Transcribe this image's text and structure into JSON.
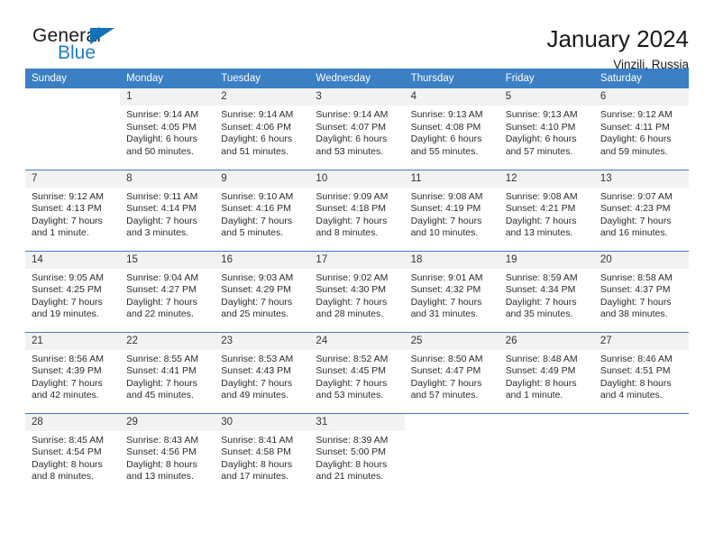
{
  "brand": {
    "name_part1": "General",
    "name_part2": "Blue",
    "flag_icon": "triangle-flag-icon"
  },
  "header": {
    "title": "January 2024",
    "location": "Vinzili, Russia"
  },
  "calendar": {
    "weekday_headers": [
      "Sunday",
      "Monday",
      "Tuesday",
      "Wednesday",
      "Thursday",
      "Friday",
      "Saturday"
    ],
    "header_bg": "#3b7fc4",
    "daynum_bg": "#f2f2f2",
    "weeks": [
      [
        {
          "day": "",
          "sunrise": "",
          "sunset": "",
          "daylight_line1": "",
          "daylight_line2": ""
        },
        {
          "day": "1",
          "sunrise": "Sunrise: 9:14 AM",
          "sunset": "Sunset: 4:05 PM",
          "daylight_line1": "Daylight: 6 hours",
          "daylight_line2": "and 50 minutes."
        },
        {
          "day": "2",
          "sunrise": "Sunrise: 9:14 AM",
          "sunset": "Sunset: 4:06 PM",
          "daylight_line1": "Daylight: 6 hours",
          "daylight_line2": "and 51 minutes."
        },
        {
          "day": "3",
          "sunrise": "Sunrise: 9:14 AM",
          "sunset": "Sunset: 4:07 PM",
          "daylight_line1": "Daylight: 6 hours",
          "daylight_line2": "and 53 minutes."
        },
        {
          "day": "4",
          "sunrise": "Sunrise: 9:13 AM",
          "sunset": "Sunset: 4:08 PM",
          "daylight_line1": "Daylight: 6 hours",
          "daylight_line2": "and 55 minutes."
        },
        {
          "day": "5",
          "sunrise": "Sunrise: 9:13 AM",
          "sunset": "Sunset: 4:10 PM",
          "daylight_line1": "Daylight: 6 hours",
          "daylight_line2": "and 57 minutes."
        },
        {
          "day": "6",
          "sunrise": "Sunrise: 9:12 AM",
          "sunset": "Sunset: 4:11 PM",
          "daylight_line1": "Daylight: 6 hours",
          "daylight_line2": "and 59 minutes."
        }
      ],
      [
        {
          "day": "7",
          "sunrise": "Sunrise: 9:12 AM",
          "sunset": "Sunset: 4:13 PM",
          "daylight_line1": "Daylight: 7 hours",
          "daylight_line2": "and 1 minute."
        },
        {
          "day": "8",
          "sunrise": "Sunrise: 9:11 AM",
          "sunset": "Sunset: 4:14 PM",
          "daylight_line1": "Daylight: 7 hours",
          "daylight_line2": "and 3 minutes."
        },
        {
          "day": "9",
          "sunrise": "Sunrise: 9:10 AM",
          "sunset": "Sunset: 4:16 PM",
          "daylight_line1": "Daylight: 7 hours",
          "daylight_line2": "and 5 minutes."
        },
        {
          "day": "10",
          "sunrise": "Sunrise: 9:09 AM",
          "sunset": "Sunset: 4:18 PM",
          "daylight_line1": "Daylight: 7 hours",
          "daylight_line2": "and 8 minutes."
        },
        {
          "day": "11",
          "sunrise": "Sunrise: 9:08 AM",
          "sunset": "Sunset: 4:19 PM",
          "daylight_line1": "Daylight: 7 hours",
          "daylight_line2": "and 10 minutes."
        },
        {
          "day": "12",
          "sunrise": "Sunrise: 9:08 AM",
          "sunset": "Sunset: 4:21 PM",
          "daylight_line1": "Daylight: 7 hours",
          "daylight_line2": "and 13 minutes."
        },
        {
          "day": "13",
          "sunrise": "Sunrise: 9:07 AM",
          "sunset": "Sunset: 4:23 PM",
          "daylight_line1": "Daylight: 7 hours",
          "daylight_line2": "and 16 minutes."
        }
      ],
      [
        {
          "day": "14",
          "sunrise": "Sunrise: 9:05 AM",
          "sunset": "Sunset: 4:25 PM",
          "daylight_line1": "Daylight: 7 hours",
          "daylight_line2": "and 19 minutes."
        },
        {
          "day": "15",
          "sunrise": "Sunrise: 9:04 AM",
          "sunset": "Sunset: 4:27 PM",
          "daylight_line1": "Daylight: 7 hours",
          "daylight_line2": "and 22 minutes."
        },
        {
          "day": "16",
          "sunrise": "Sunrise: 9:03 AM",
          "sunset": "Sunset: 4:29 PM",
          "daylight_line1": "Daylight: 7 hours",
          "daylight_line2": "and 25 minutes."
        },
        {
          "day": "17",
          "sunrise": "Sunrise: 9:02 AM",
          "sunset": "Sunset: 4:30 PM",
          "daylight_line1": "Daylight: 7 hours",
          "daylight_line2": "and 28 minutes."
        },
        {
          "day": "18",
          "sunrise": "Sunrise: 9:01 AM",
          "sunset": "Sunset: 4:32 PM",
          "daylight_line1": "Daylight: 7 hours",
          "daylight_line2": "and 31 minutes."
        },
        {
          "day": "19",
          "sunrise": "Sunrise: 8:59 AM",
          "sunset": "Sunset: 4:34 PM",
          "daylight_line1": "Daylight: 7 hours",
          "daylight_line2": "and 35 minutes."
        },
        {
          "day": "20",
          "sunrise": "Sunrise: 8:58 AM",
          "sunset": "Sunset: 4:37 PM",
          "daylight_line1": "Daylight: 7 hours",
          "daylight_line2": "and 38 minutes."
        }
      ],
      [
        {
          "day": "21",
          "sunrise": "Sunrise: 8:56 AM",
          "sunset": "Sunset: 4:39 PM",
          "daylight_line1": "Daylight: 7 hours",
          "daylight_line2": "and 42 minutes."
        },
        {
          "day": "22",
          "sunrise": "Sunrise: 8:55 AM",
          "sunset": "Sunset: 4:41 PM",
          "daylight_line1": "Daylight: 7 hours",
          "daylight_line2": "and 45 minutes."
        },
        {
          "day": "23",
          "sunrise": "Sunrise: 8:53 AM",
          "sunset": "Sunset: 4:43 PM",
          "daylight_line1": "Daylight: 7 hours",
          "daylight_line2": "and 49 minutes."
        },
        {
          "day": "24",
          "sunrise": "Sunrise: 8:52 AM",
          "sunset": "Sunset: 4:45 PM",
          "daylight_line1": "Daylight: 7 hours",
          "daylight_line2": "and 53 minutes."
        },
        {
          "day": "25",
          "sunrise": "Sunrise: 8:50 AM",
          "sunset": "Sunset: 4:47 PM",
          "daylight_line1": "Daylight: 7 hours",
          "daylight_line2": "and 57 minutes."
        },
        {
          "day": "26",
          "sunrise": "Sunrise: 8:48 AM",
          "sunset": "Sunset: 4:49 PM",
          "daylight_line1": "Daylight: 8 hours",
          "daylight_line2": "and 1 minute."
        },
        {
          "day": "27",
          "sunrise": "Sunrise: 8:46 AM",
          "sunset": "Sunset: 4:51 PM",
          "daylight_line1": "Daylight: 8 hours",
          "daylight_line2": "and 4 minutes."
        }
      ],
      [
        {
          "day": "28",
          "sunrise": "Sunrise: 8:45 AM",
          "sunset": "Sunset: 4:54 PM",
          "daylight_line1": "Daylight: 8 hours",
          "daylight_line2": "and 8 minutes."
        },
        {
          "day": "29",
          "sunrise": "Sunrise: 8:43 AM",
          "sunset": "Sunset: 4:56 PM",
          "daylight_line1": "Daylight: 8 hours",
          "daylight_line2": "and 13 minutes."
        },
        {
          "day": "30",
          "sunrise": "Sunrise: 8:41 AM",
          "sunset": "Sunset: 4:58 PM",
          "daylight_line1": "Daylight: 8 hours",
          "daylight_line2": "and 17 minutes."
        },
        {
          "day": "31",
          "sunrise": "Sunrise: 8:39 AM",
          "sunset": "Sunset: 5:00 PM",
          "daylight_line1": "Daylight: 8 hours",
          "daylight_line2": "and 21 minutes."
        },
        {
          "day": "",
          "sunrise": "",
          "sunset": "",
          "daylight_line1": "",
          "daylight_line2": ""
        },
        {
          "day": "",
          "sunrise": "",
          "sunset": "",
          "daylight_line1": "",
          "daylight_line2": ""
        },
        {
          "day": "",
          "sunrise": "",
          "sunset": "",
          "daylight_line1": "",
          "daylight_line2": ""
        }
      ]
    ]
  }
}
